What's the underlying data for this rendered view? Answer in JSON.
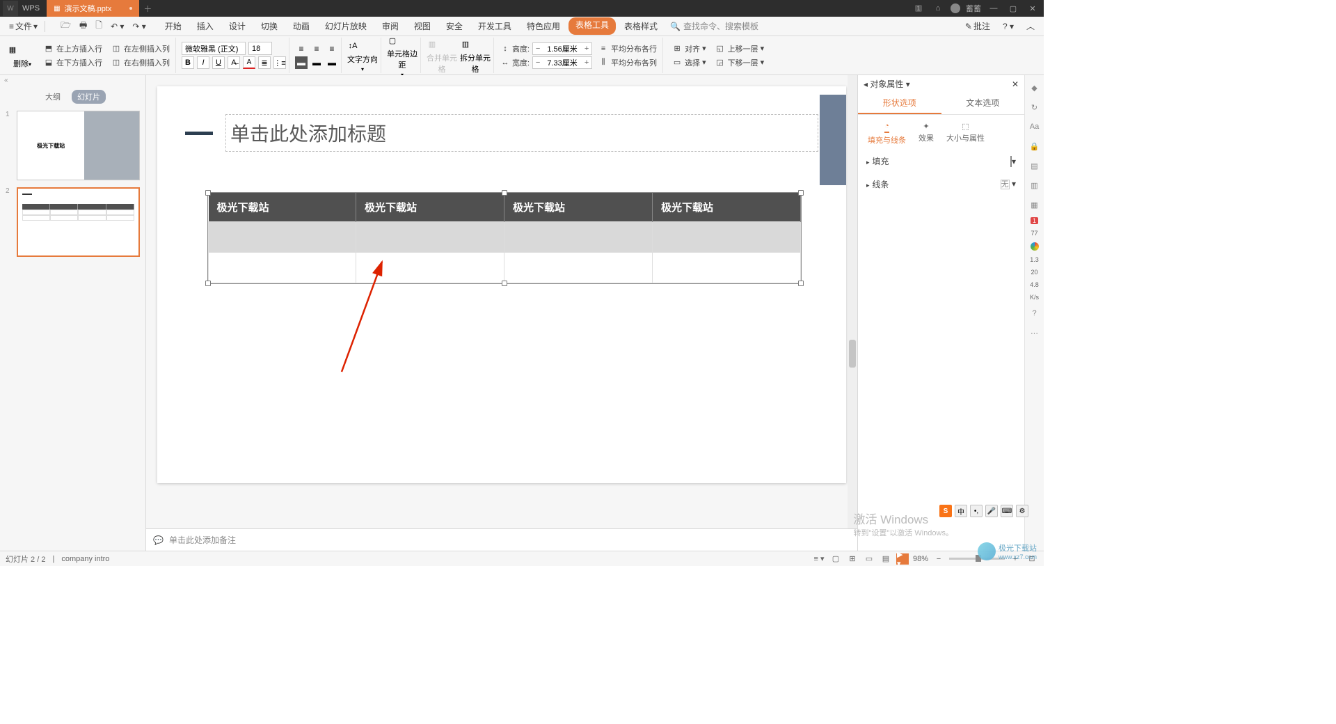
{
  "titlebar": {
    "app": "WPS",
    "filename": "演示文稿.pptx",
    "notif_count": "1",
    "user": "蓄蓄"
  },
  "menubar": {
    "file": "文件",
    "tabs": [
      "开始",
      "插入",
      "设计",
      "切换",
      "动画",
      "幻灯片放映",
      "审阅",
      "视图",
      "安全",
      "开发工具",
      "特色应用",
      "表格工具",
      "表格样式"
    ],
    "active_tab": "表格工具",
    "search_placeholder": "查找命令、搜索模板",
    "annotate": "批注"
  },
  "ribbon": {
    "delete": "删除",
    "insert_row_above": "在上方插入行",
    "insert_row_below": "在下方插入行",
    "insert_col_left": "在左侧插入列",
    "insert_col_right": "在右侧插入列",
    "font_name": "微软雅黑 (正文)",
    "font_size": "18",
    "text_direction": "文字方向",
    "cell_margin": "单元格边距",
    "merge_cells": "合并单元格",
    "split_cells": "拆分单元格",
    "height_label": "高度:",
    "height_val": "1.56厘米",
    "width_label": "宽度:",
    "width_val": "7.33厘米",
    "dist_rows": "平均分布各行",
    "dist_cols": "平均分布各列",
    "align": "对齐",
    "select": "选择",
    "bring_forward": "上移一层",
    "send_backward": "下移一层"
  },
  "thumb_tabs": {
    "outline": "大纲",
    "slides": "幻灯片"
  },
  "thumb1_text": "极光下载站",
  "slide": {
    "title_placeholder": "单击此处添加标题",
    "headers": [
      "极光下载站",
      "极光下载站",
      "极光下载站",
      "极光下载站"
    ]
  },
  "notes_placeholder": "单击此处添加备注",
  "right_pane": {
    "title": "对象属性",
    "tab_shape": "形状选项",
    "tab_text": "文本选项",
    "sub_fill_stroke": "填充与线条",
    "sub_effect": "效果",
    "sub_size": "大小与属性",
    "sec_fill": "填充",
    "sec_line": "线条",
    "none_label": "无"
  },
  "far_right": {
    "score": "77",
    "v1": "1.3",
    "v2": "20",
    "v3": "4.8",
    "unit": "K/s"
  },
  "status": {
    "slide_counter": "幻灯片 2 / 2",
    "template": "company intro",
    "zoom": "98%"
  },
  "win_activate": {
    "l1": "激活 Windows",
    "l2": "转到\"设置\"以激活 Windows。"
  },
  "watermark": {
    "name": "极光下载站",
    "url": "www.xz7.com"
  },
  "ime": "中"
}
